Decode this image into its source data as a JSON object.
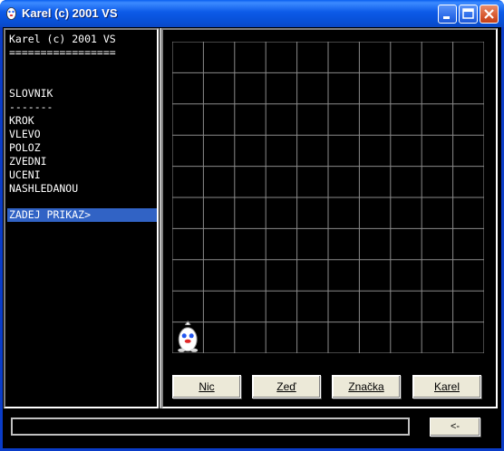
{
  "window": {
    "title": "Karel (c) 2001 VS"
  },
  "console": {
    "lines": [
      "Karel (c) 2001 VS",
      "=================",
      "",
      "",
      "SLOVNIK",
      "-------",
      "KROK",
      "VLEVO",
      "POLOZ",
      "ZVEDNI",
      "UCENI",
      "NASHLEDANOU",
      ""
    ],
    "prompt": "ZADEJ PRIKAZ>"
  },
  "grid": {
    "columns": 10,
    "rows": 10,
    "karel_position": {
      "column": 1,
      "row": 10
    }
  },
  "buttons": {
    "nic": "Nic",
    "zed": "Zeď",
    "znacka": "Značka",
    "karel": "Karel"
  },
  "command": {
    "value": "",
    "submit_label": "<-"
  },
  "colors": {
    "titlebar": "#0A5FEF",
    "highlight": "#3163C5",
    "grid_line": "#8a8a8a"
  }
}
